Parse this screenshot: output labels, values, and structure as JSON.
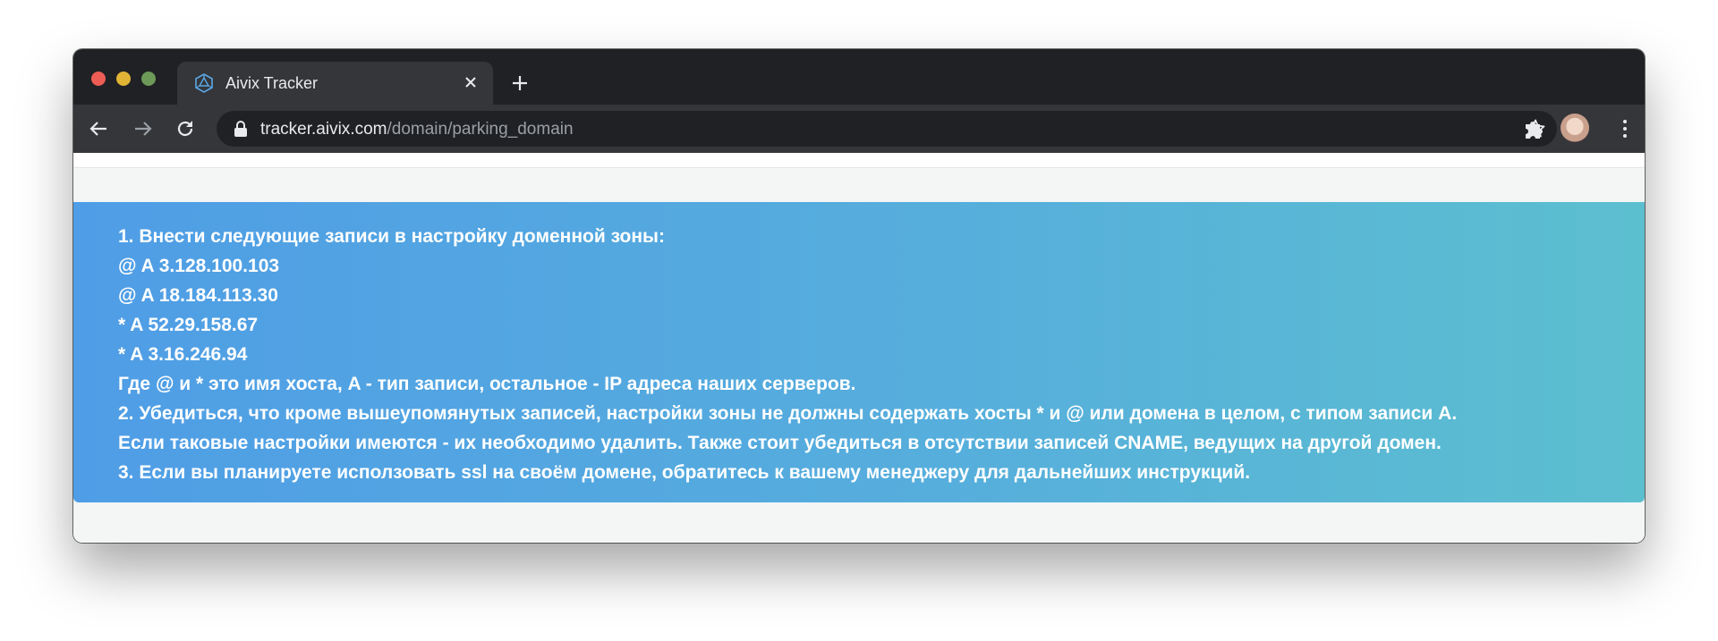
{
  "browser": {
    "tab": {
      "title": "Aivix Tracker"
    },
    "url": {
      "host": "tracker.aivix.com",
      "path": "/domain/parking_domain"
    },
    "colors": {
      "tabbar": "#202124",
      "toolbar": "#35363a",
      "traffic_red": "#ee5d55",
      "traffic_yellow": "#e1b436",
      "traffic_green": "#6d9a58"
    }
  },
  "page": {
    "banner": {
      "gradient_start": "#4f9de6",
      "gradient_end": "#5cbfcf",
      "lines": [
        "1. Внести следующие записи в настройку доменной зоны:",
        "@ A 3.128.100.103",
        "@ A 18.184.113.30",
        "* A 52.29.158.67",
        "* A 3.16.246.94",
        "Где @ и * это имя хоста, A - тип записи, остальное - IP адреса наших серверов.",
        "2. Убедиться, что кроме вышеупомянутых записей, настройки зоны не должны содержать хосты * и @ или домена в целом, с типом записи А.",
        "Если таковые настройки имеются - их необходимо удалить. Также стоит убедиться в отсутствии записей CNAME, ведущих на другой домен.",
        "3. Если вы планируете исползовать ssl на своём домене, обратитесь к вашему менеджеру для дальнейших инструкций."
      ]
    }
  }
}
